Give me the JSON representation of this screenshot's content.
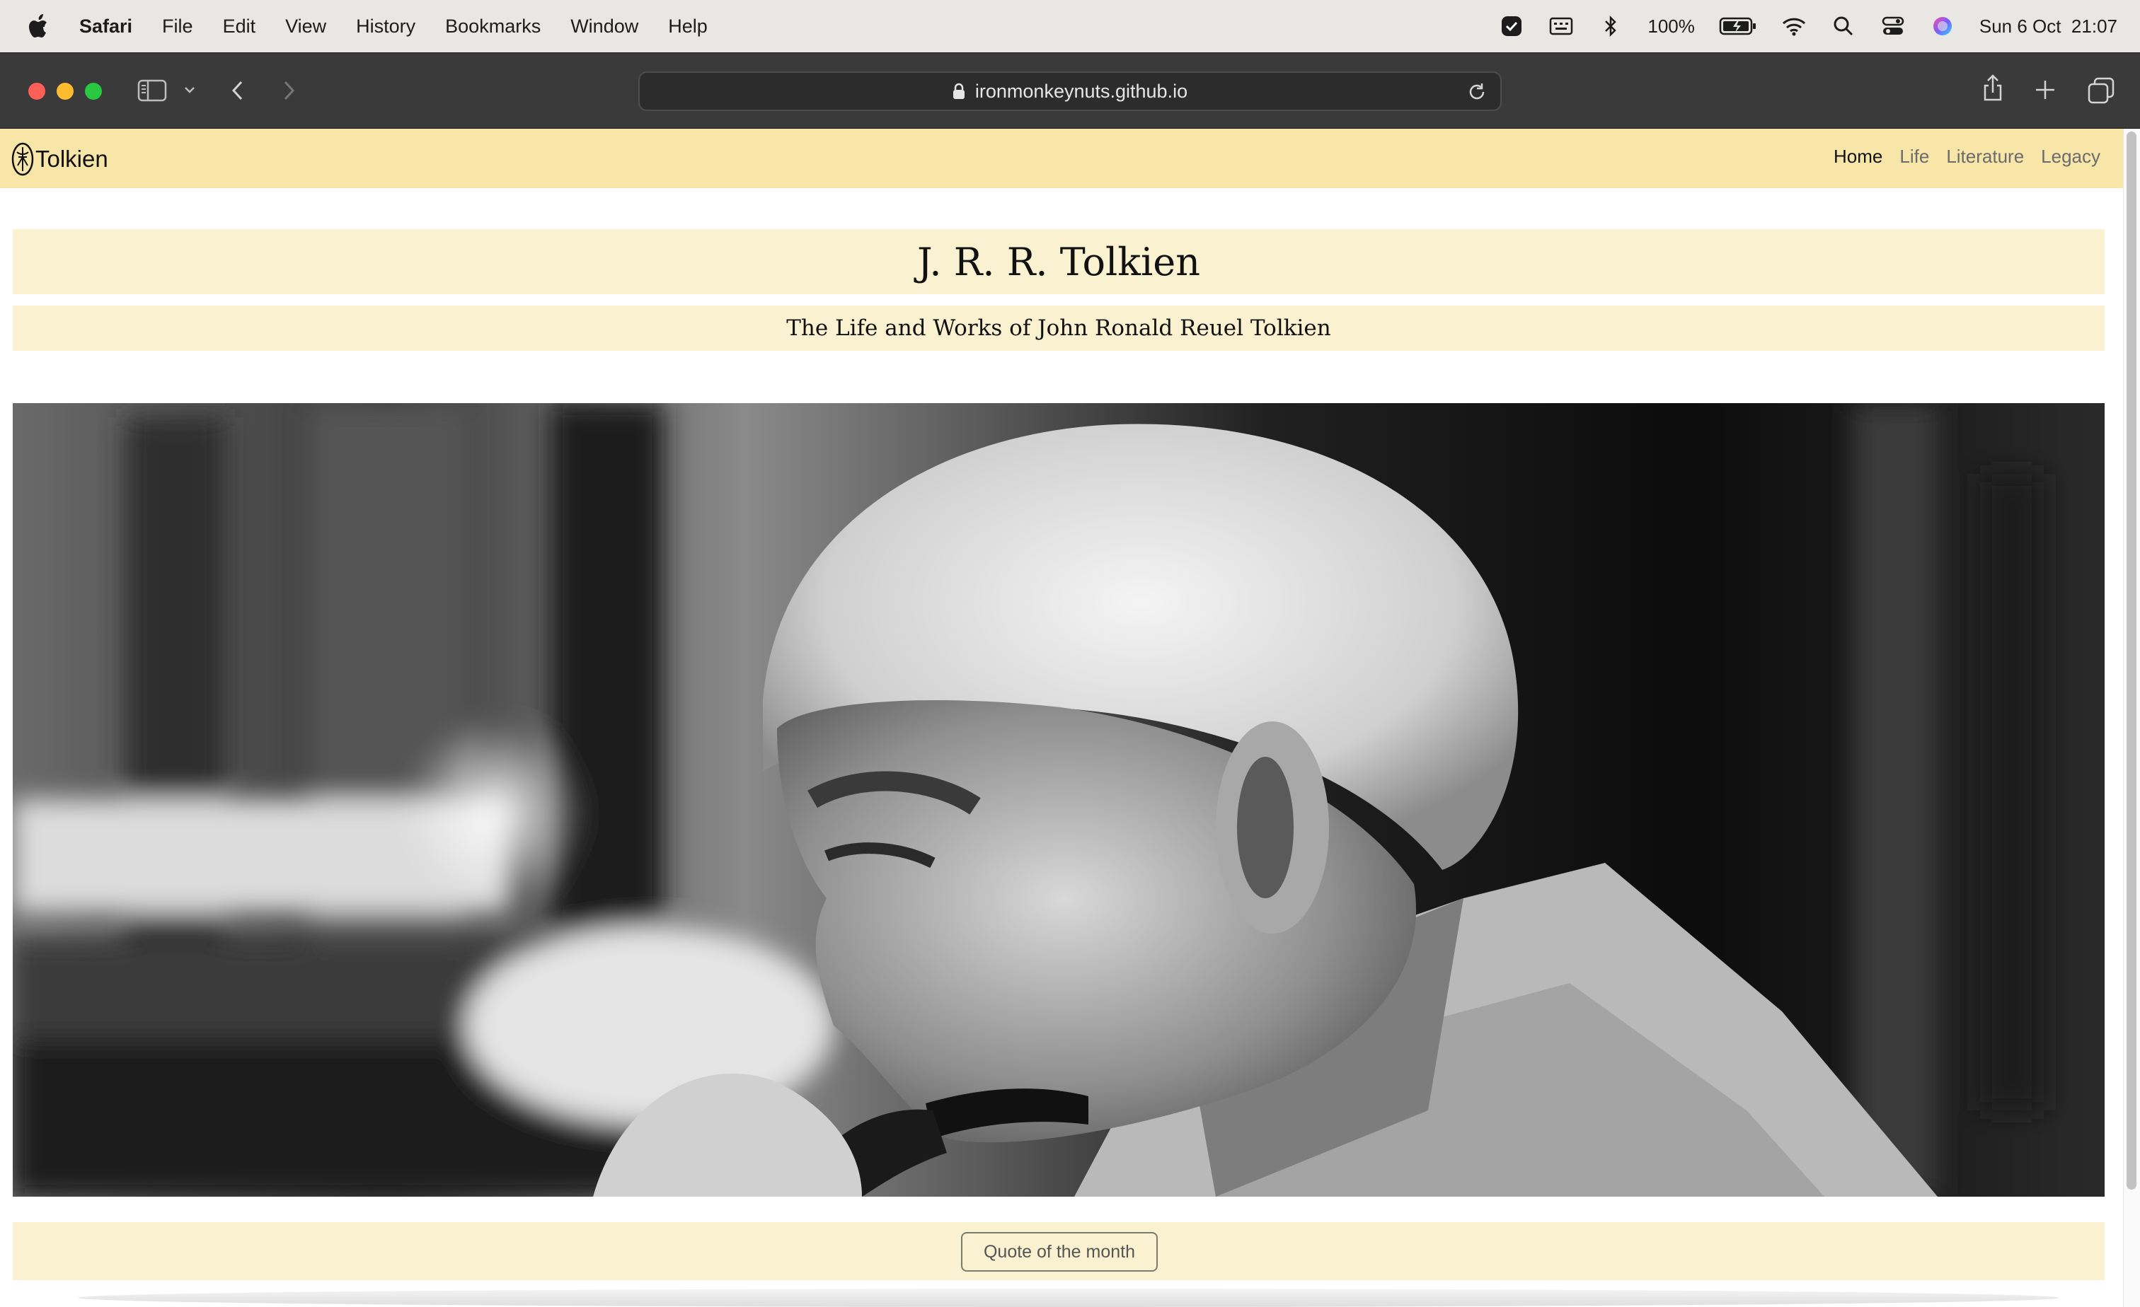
{
  "menubar": {
    "app_name": "Safari",
    "menus": [
      "File",
      "Edit",
      "View",
      "History",
      "Bookmarks",
      "Window",
      "Help"
    ],
    "battery": "100%",
    "clock": "Sun 6 Oct  21:07"
  },
  "browser": {
    "url": "ironmonkeynuts.github.io"
  },
  "site": {
    "brand": "Tolkien",
    "nav": [
      {
        "label": "Home",
        "active": true
      },
      {
        "label": "Life",
        "active": false
      },
      {
        "label": "Literature",
        "active": false
      },
      {
        "label": "Legacy",
        "active": false
      }
    ],
    "title": "J. R. R. Tolkien",
    "subtitle": "The Life and Works of John Ronald Reuel Tolkien",
    "quote_button": "Quote of the month"
  },
  "colors": {
    "navbar": "#f8e6a9",
    "band": "#f9f1cf",
    "toolbar": "#3a3a3a"
  }
}
